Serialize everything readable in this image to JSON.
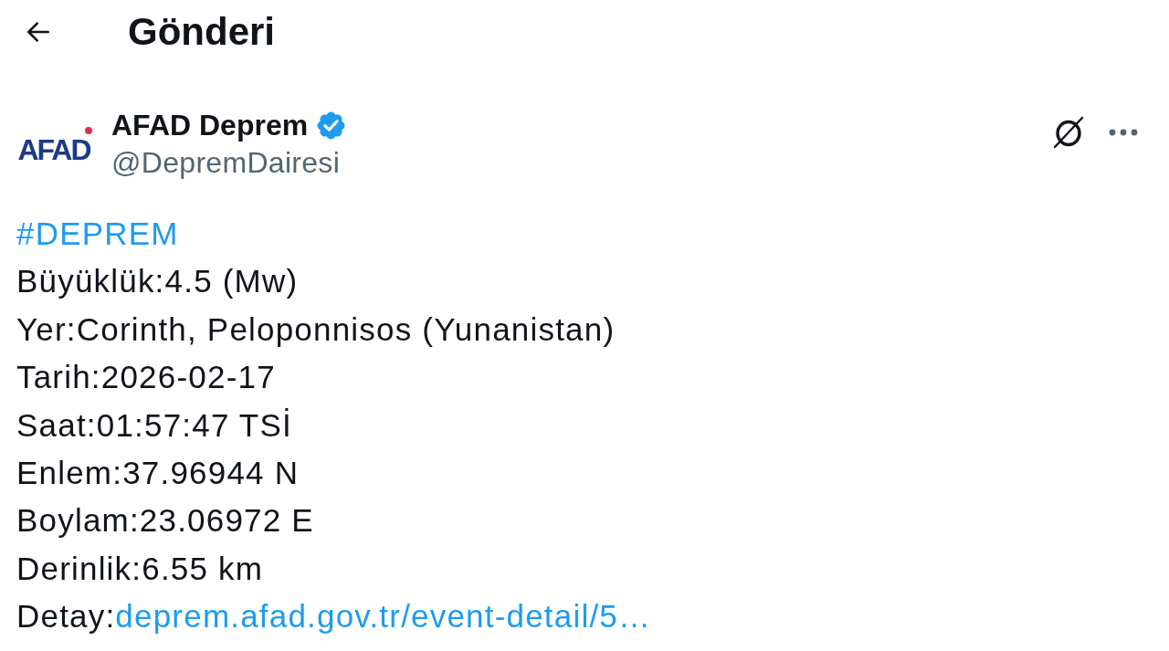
{
  "header": {
    "title": "Gönderi"
  },
  "post": {
    "author": {
      "logo_text": "AFAD",
      "name": "AFAD Deprem",
      "verified": true,
      "handle": "@DepremDairesi"
    },
    "lines": [
      {
        "kind": "hashtag",
        "text": "#DEPREM"
      },
      {
        "kind": "text",
        "text": "Büyüklük:4.5 (Mw)"
      },
      {
        "kind": "text",
        "text": "Yer:Corinth, Peloponnisos (Yunanistan)"
      },
      {
        "kind": "text",
        "text": "Tarih:2026-02-17"
      },
      {
        "kind": "text",
        "text": "Saat:01:57:47 TSİ"
      },
      {
        "kind": "text",
        "text": "Enlem:37.96944 N"
      },
      {
        "kind": "text",
        "text": "Boylam:23.06972 E"
      },
      {
        "kind": "text",
        "text": "Derinlik:6.55 km"
      },
      {
        "kind": "link",
        "text": "Detay:",
        "link": "deprem.afad.gov.tr/event-detail/5…"
      }
    ]
  }
}
